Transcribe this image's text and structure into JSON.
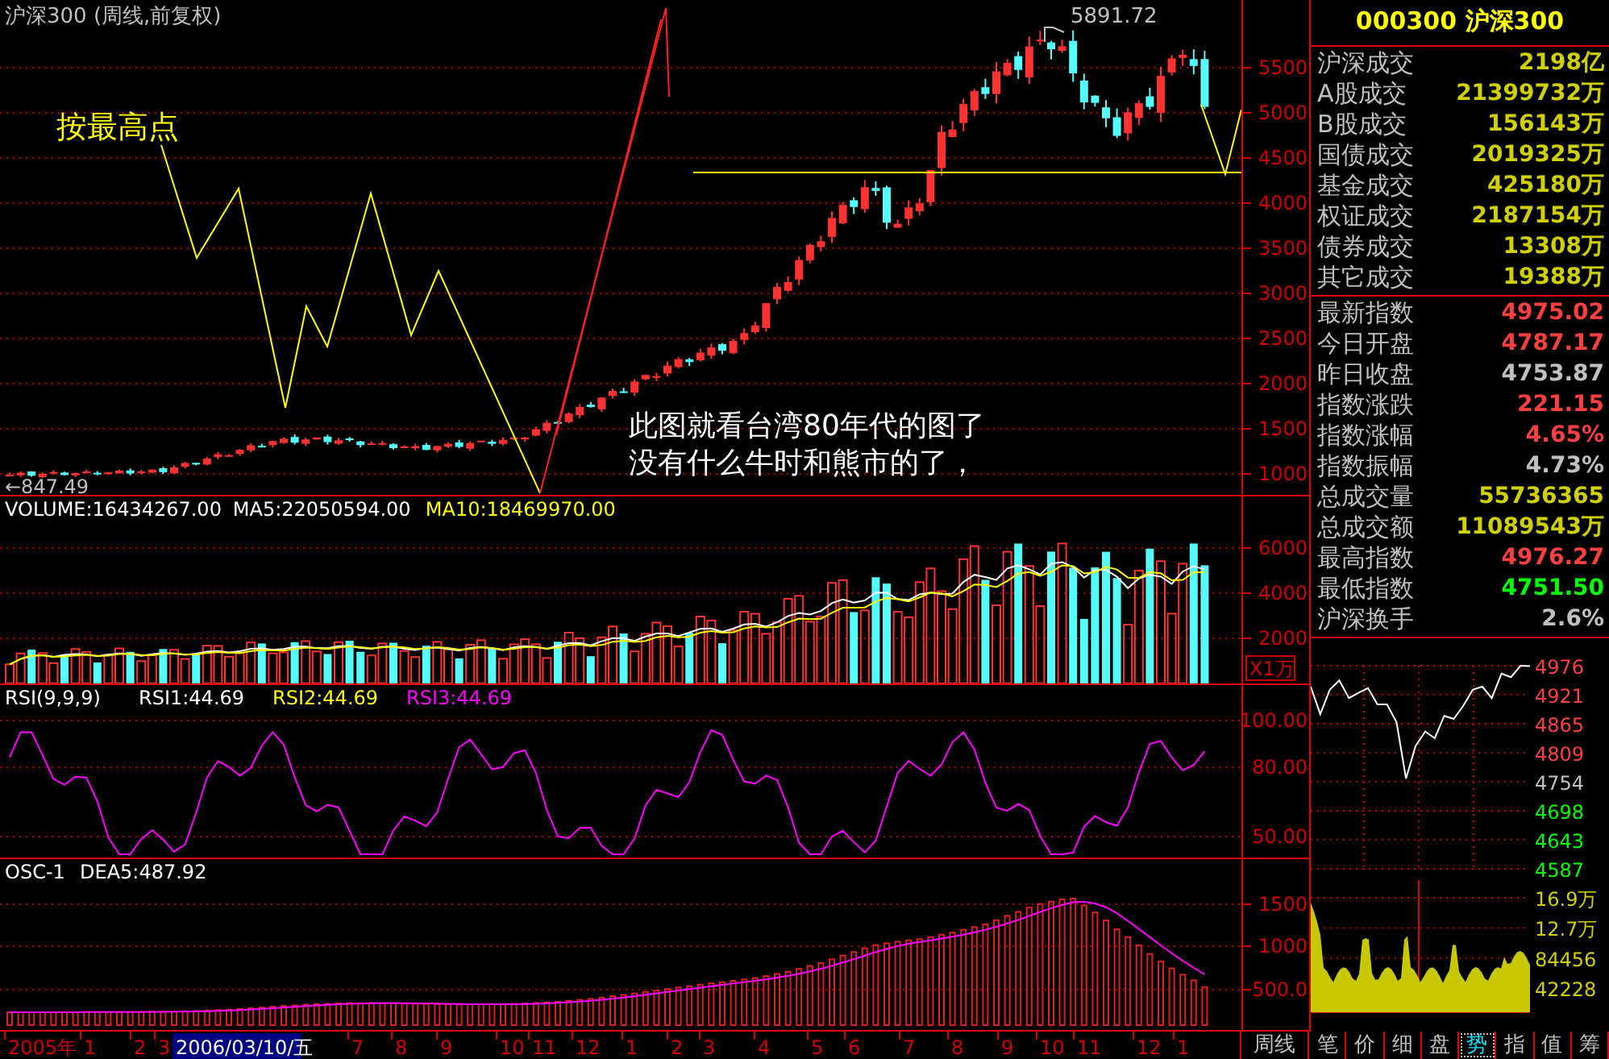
{
  "price_panel": {
    "title": "沪深300 (周线,前复权)",
    "annotation": "按最高点",
    "peak_label": "5891.72",
    "low_label": "←847.49",
    "comment_lines": [
      "此图就看台湾80年代的图了",
      "没有什么牛时和熊市的了，"
    ],
    "axis_labels": [
      "5500",
      "5000",
      "4500",
      "4000",
      "3500",
      "3000",
      "2500",
      "2000",
      "1500",
      "1000"
    ]
  },
  "volume_panel": {
    "indicators": [
      {
        "text": "VOLUME:16434267.00",
        "color": "#ffffff"
      },
      {
        "text": "MA5:22050594.00",
        "color": "#ffffff"
      },
      {
        "text": "MA10:18469970.00",
        "color": "#ffff00"
      }
    ],
    "axis_labels": [
      "6000",
      "4000",
      "2000"
    ],
    "unit_label": "X1万"
  },
  "rsi_panel": {
    "indicators": [
      {
        "text": "RSI(9,9,9)",
        "color": "#ffffff"
      },
      {
        "text": "RSI1:44.69",
        "color": "#ffffff"
      },
      {
        "text": "RSI2:44.69",
        "color": "#ffff00"
      },
      {
        "text": "RSI3:44.69",
        "color": "#ff00ff"
      }
    ],
    "axis_labels": [
      "100.00",
      "80.00",
      "50.00"
    ]
  },
  "osc_panel": {
    "indicators": [
      {
        "text": "OSC-1",
        "color": "#ffffff"
      },
      {
        "text": "DEA5:487.92",
        "color": "#ffffff"
      }
    ],
    "axis_labels": [
      "1500",
      "1000",
      "500.0"
    ]
  },
  "date_axis": {
    "labels": [
      "2005年",
      "1",
      "2",
      "3",
      "7",
      "8",
      "9",
      "10",
      "11",
      "12",
      "1",
      "2",
      "3",
      "4",
      "5",
      "6",
      "7",
      "8",
      "9",
      "10",
      "11",
      "12",
      "1"
    ],
    "cursor_label": "2006/03/10/五"
  },
  "quote_panel": {
    "title": "000300 沪深300",
    "trade_rows": [
      {
        "label": "沪深成交",
        "value": "2198亿"
      },
      {
        "label": "A股成交",
        "value": "21399732万"
      },
      {
        "label": "B股成交",
        "value": "156143万"
      },
      {
        "label": "国债成交",
        "value": "2019325万"
      },
      {
        "label": "基金成交",
        "value": "425180万"
      },
      {
        "label": "权证成交",
        "value": "2187154万"
      },
      {
        "label": "债券成交",
        "value": "13308万"
      },
      {
        "label": "其它成交",
        "value": "19388万"
      }
    ],
    "index_rows": [
      {
        "label": "最新指数",
        "value": "4975.02",
        "color": "#ff4040"
      },
      {
        "label": "今日开盘",
        "value": "4787.17",
        "color": "#ff4040"
      },
      {
        "label": "昨日收盘",
        "value": "4753.87",
        "color": "#c0c0c0"
      },
      {
        "label": "指数涨跌",
        "value": "221.15",
        "color": "#ff4040"
      },
      {
        "label": "指数涨幅",
        "value": "4.65%",
        "color": "#ff4040"
      },
      {
        "label": "指数振幅",
        "value": "4.73%",
        "color": "#c0c0c0"
      },
      {
        "label": "总成交量",
        "value": "55736365",
        "color": "#d0d000"
      },
      {
        "label": "总成交额",
        "value": "11089543万",
        "color": "#d0d000"
      },
      {
        "label": "最高指数",
        "value": "4976.27",
        "color": "#ff4040"
      },
      {
        "label": "最低指数",
        "value": "4751.50",
        "color": "#00ff00"
      },
      {
        "label": "沪深换手",
        "value": "2.6%",
        "color": "#c0c0c0"
      }
    ]
  },
  "intraday_chart": {
    "chart_data": {
      "type": "line",
      "grid": true,
      "ylim": [
        4587,
        4976
      ],
      "yticks": [
        4976,
        4921,
        4865,
        4809,
        4754,
        4698,
        4643,
        4587
      ],
      "series": [
        {
          "color": "#ffffff",
          "values": [
            4936,
            4883,
            4930,
            4948,
            4914,
            4924,
            4933,
            4902,
            4902,
            4868,
            4760,
            4822,
            4850,
            4837,
            4880,
            4874,
            4899,
            4930,
            4936,
            4914,
            4961,
            4954,
            4976,
            4975
          ]
        }
      ]
    },
    "price_labels": [
      {
        "text": "4976",
        "color": "#ff4040"
      },
      {
        "text": "4921",
        "color": "#ff4040"
      },
      {
        "text": "4865",
        "color": "#ff4040"
      },
      {
        "text": "4809",
        "color": "#ff4040"
      },
      {
        "text": "4754",
        "color": "#c0c0c0"
      },
      {
        "text": "4698",
        "color": "#00ff00"
      },
      {
        "text": "4643",
        "color": "#00ff00"
      },
      {
        "text": "4587",
        "color": "#00ff00"
      }
    ],
    "volume_labels": [
      {
        "text": "16.9万",
        "color": "#d0d000"
      },
      {
        "text": "12.7万",
        "color": "#d0d000"
      },
      {
        "text": "84456",
        "color": "#d0d000"
      },
      {
        "text": "42228",
        "color": "#d0d000"
      }
    ]
  },
  "tabs": [
    {
      "label": "周线",
      "selected": false
    },
    {
      "label": "笔",
      "selected": false
    },
    {
      "label": "价",
      "selected": false
    },
    {
      "label": "细",
      "selected": false
    },
    {
      "label": "盘",
      "selected": false
    },
    {
      "label": "势",
      "selected": true
    },
    {
      "label": "指",
      "selected": false
    },
    {
      "label": "值",
      "selected": false
    },
    {
      "label": "筹",
      "selected": false
    }
  ]
}
